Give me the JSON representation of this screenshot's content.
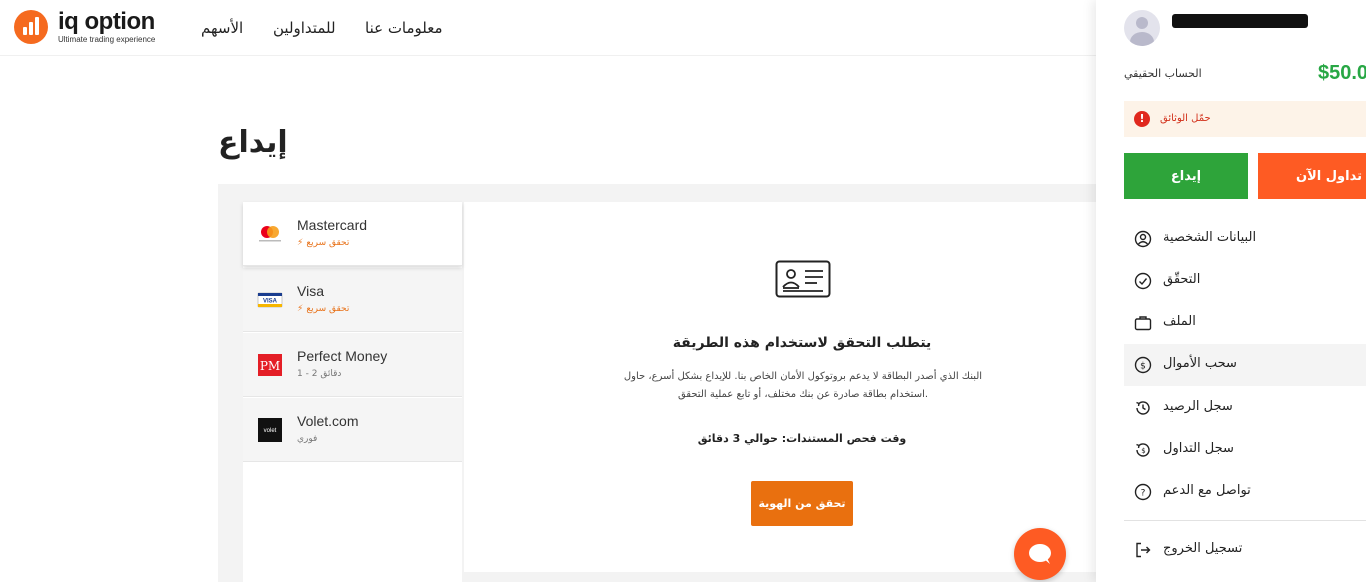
{
  "header": {
    "logo_title": "iq option",
    "logo_subtitle": "Ultimate trading experience",
    "nav": [
      "الأسهم",
      "للمتداولين",
      "معلومات عنا"
    ]
  },
  "page_title": "إيداع",
  "payment_methods": [
    {
      "name": "Mastercard",
      "subtitle": "تحقق سريع",
      "icon": "mastercard-icon",
      "fast": true
    },
    {
      "name": "Visa",
      "subtitle": "تحقق سريع",
      "icon": "visa-icon",
      "fast": true
    },
    {
      "name": "Perfect Money",
      "subtitle": "دقائق 2 - 1",
      "icon": "perfect-money-icon",
      "fast": false
    },
    {
      "name": "Volet.com",
      "subtitle": "فوري",
      "icon": "volet-icon",
      "fast": false
    }
  ],
  "detail": {
    "title": "يتطلب التحقق لاستخدام هذه الطريقة",
    "text_line1": "البنك الذي أصدر البطاقة لا يدعم بروتوكول الأمان الخاص بنا. للإيداع بشكل أسرع، حاول",
    "text_line2": ".استخدام بطاقة صادرة عن بنك مختلف، أو تابع عملية التحقق",
    "time": "وقت فحص المستندات: حوالي 3 دقائق",
    "button": "تحقق من الهوية"
  },
  "panel": {
    "account_type": "الحساب الحقيقي",
    "balance": "$50.0",
    "warning": "حمّل الوثائق",
    "trade_button": "تداول الآن",
    "deposit_button": "إيداع",
    "menu": [
      {
        "label": "البيانات الشخصية",
        "icon": "user-icon"
      },
      {
        "label": "التحقّق",
        "icon": "check-circle-icon"
      },
      {
        "label": "الملف",
        "icon": "briefcase-icon"
      },
      {
        "label": "سحب الأموال",
        "icon": "dollar-circle-icon"
      },
      {
        "label": "سجل الرصيد",
        "icon": "history-icon"
      },
      {
        "label": "سجل التداول",
        "icon": "trade-history-icon"
      },
      {
        "label": "تواصل مع الدعم",
        "icon": "help-icon"
      },
      {
        "label": "تسجيل الخروج",
        "icon": "logout-icon"
      }
    ]
  },
  "colors": {
    "brand_orange": "#fe5b23",
    "deposit_green": "#2ea43a",
    "balance_green": "#28a745",
    "verify_orange": "#e9700f"
  }
}
